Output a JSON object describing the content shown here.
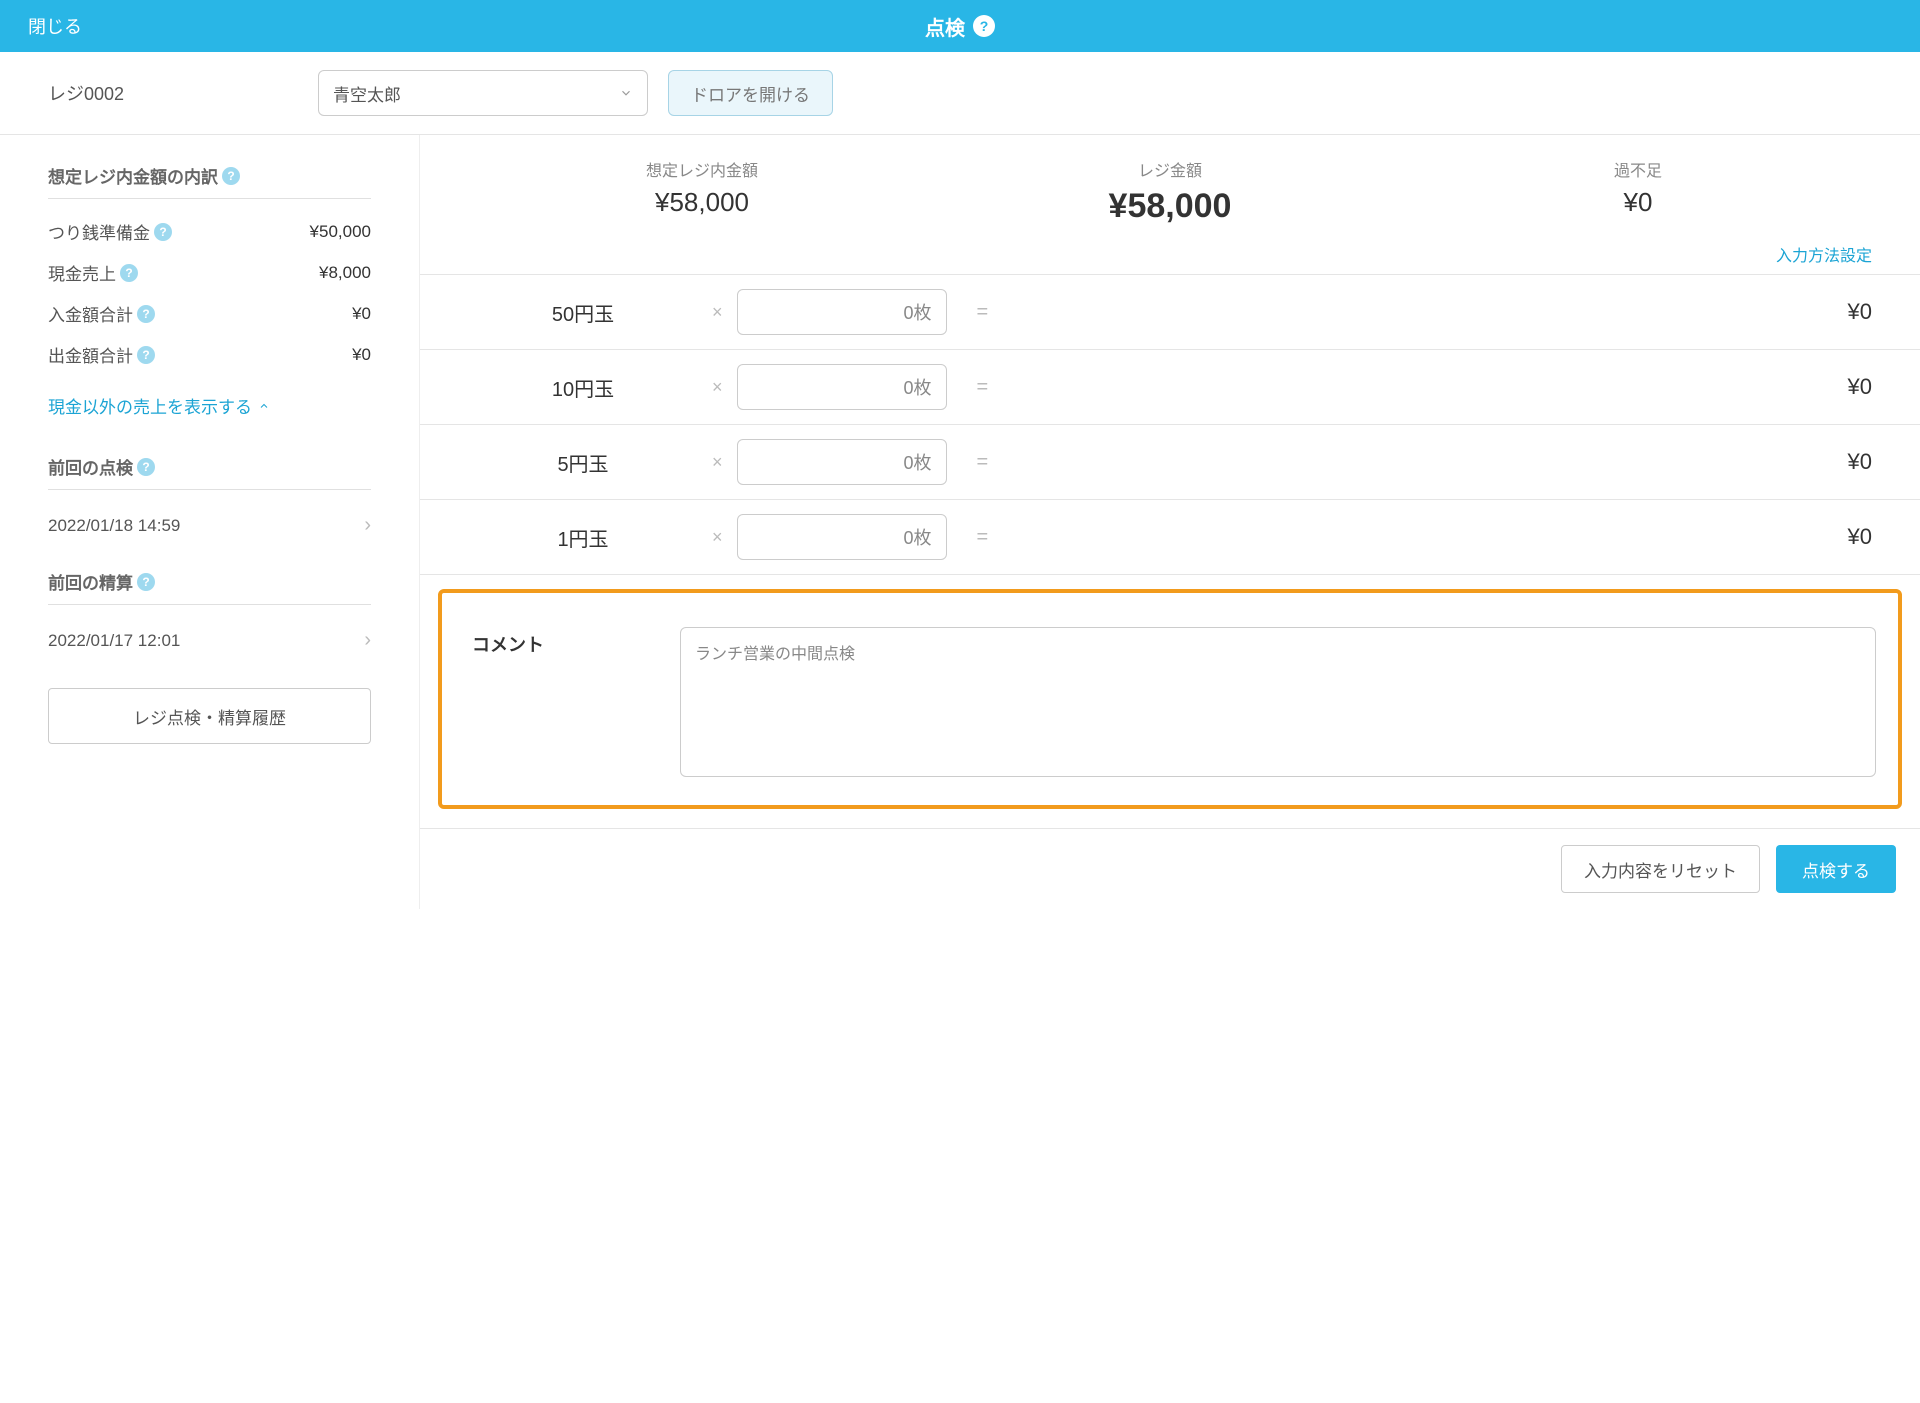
{
  "header": {
    "close": "閉じる",
    "title": "点検"
  },
  "topbar": {
    "register_name": "レジ0002",
    "staff_selected": "青空太郎",
    "open_drawer": "ドロアを開ける"
  },
  "sidebar": {
    "breakdown_title": "想定レジ内金額の内訳",
    "items": [
      {
        "label": "つり銭準備金",
        "value": "¥50,000"
      },
      {
        "label": "現金売上",
        "value": "¥8,000"
      },
      {
        "label": "入金額合計",
        "value": "¥0"
      },
      {
        "label": "出金額合計",
        "value": "¥0"
      }
    ],
    "show_noncash_link": "現金以外の売上を表示する",
    "last_check_title": "前回の点検",
    "last_check_time": "2022/01/18 14:59",
    "last_settle_title": "前回の精算",
    "last_settle_time": "2022/01/17 12:01",
    "history_button": "レジ点検・精算履歴"
  },
  "summary": {
    "expected_label": "想定レジ内金額",
    "expected_value": "¥58,000",
    "actual_label": "レジ金額",
    "actual_value": "¥58,000",
    "diff_label": "過不足",
    "diff_value": "¥0",
    "input_settings": "入力方法設定"
  },
  "denominations": [
    {
      "name": "50円玉",
      "count": "0枚",
      "total": "¥0"
    },
    {
      "name": "10円玉",
      "count": "0枚",
      "total": "¥0"
    },
    {
      "name": "5円玉",
      "count": "0枚",
      "total": "¥0"
    },
    {
      "name": "1円玉",
      "count": "0枚",
      "total": "¥0"
    }
  ],
  "symbols": {
    "times": "×",
    "equals": "="
  },
  "comment": {
    "label": "コメント",
    "value": "ランチ営業の中間点検"
  },
  "footer": {
    "reset": "入力内容をリセット",
    "submit": "点検する"
  }
}
